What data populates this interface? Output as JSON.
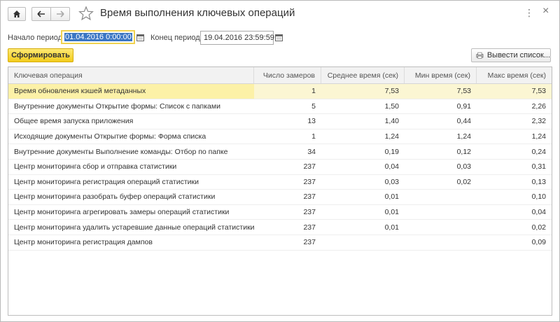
{
  "window": {
    "title": "Время выполнения ключевых операций",
    "more_label": "⋮",
    "close_label": "×"
  },
  "period": {
    "start_label": "Начало периода:",
    "start_value": "01.04.2016  0:00:00",
    "end_label": "Конец периода:",
    "end_value": "19.04.2016 23:59:59"
  },
  "toolbar": {
    "generate_label": "Сформировать",
    "export_label": "Вывести список..."
  },
  "table": {
    "columns": [
      "Ключевая операция",
      "Число замеров",
      "Среднее время (сек)",
      "Мин время (сек)",
      "Макс время (сек)"
    ],
    "rows": [
      {
        "operation": "Время обновления кэшей метаданных",
        "count": "1",
        "avg": "7,53",
        "min": "7,53",
        "max": "7,53"
      },
      {
        "operation": "Внутренние документы Открытие формы: Список с папками",
        "count": "5",
        "avg": "1,50",
        "min": "0,91",
        "max": "2,26"
      },
      {
        "operation": "Общее время запуска приложения",
        "count": "13",
        "avg": "1,40",
        "min": "0,44",
        "max": "2,32"
      },
      {
        "operation": "Исходящие документы Открытие формы: Форма списка",
        "count": "1",
        "avg": "1,24",
        "min": "1,24",
        "max": "1,24"
      },
      {
        "operation": "Внутренние документы Выполнение команды: Отбор по папке",
        "count": "34",
        "avg": "0,19",
        "min": "0,12",
        "max": "0,24"
      },
      {
        "operation": "Центр мониторинга сбор и отправка статистики",
        "count": "237",
        "avg": "0,04",
        "min": "0,03",
        "max": "0,31"
      },
      {
        "operation": "Центр мониторинга регистрация операций статистики",
        "count": "237",
        "avg": "0,03",
        "min": "0,02",
        "max": "0,13"
      },
      {
        "operation": "Центр мониторинга разобрать буфер операций статистики",
        "count": "237",
        "avg": "0,01",
        "min": "",
        "max": "0,10"
      },
      {
        "operation": "Центр мониторинга агрегировать замеры операций статистики",
        "count": "237",
        "avg": "0,01",
        "min": "",
        "max": "0,04"
      },
      {
        "operation": "Центр мониторинга удалить устаревшие данные операций статистики",
        "count": "237",
        "avg": "0,01",
        "min": "",
        "max": "0,02"
      },
      {
        "operation": "Центр мониторинга регистрация дампов",
        "count": "237",
        "avg": "",
        "min": "",
        "max": "0,09"
      }
    ],
    "selected_row": 0
  },
  "colors": {
    "accent_yellow": "#f2cc1d",
    "selected_row": "#fcf1a7",
    "selection_blue": "#3b76c4"
  },
  "icons": [
    "home-icon",
    "arrow-left-icon",
    "arrow-right-icon",
    "star-icon",
    "calendar-icon",
    "print-list-icon"
  ]
}
